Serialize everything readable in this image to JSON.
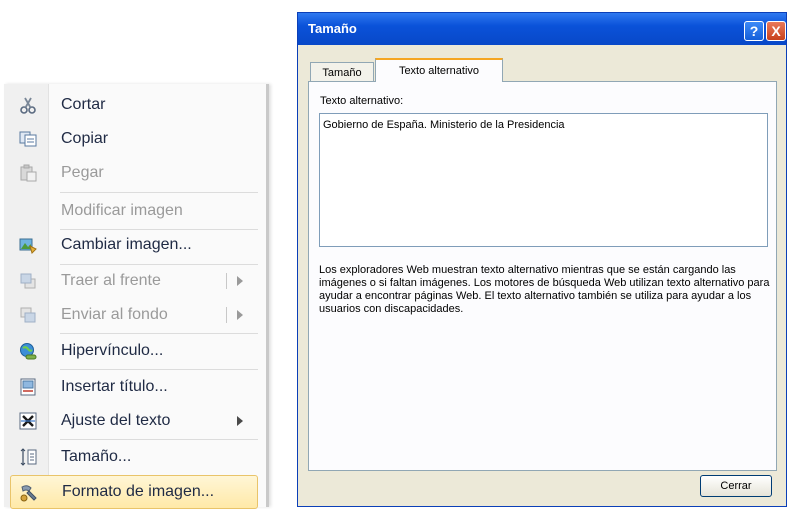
{
  "context_menu": {
    "items": [
      {
        "label": "Cortar",
        "icon": "scissors-icon",
        "enabled": true
      },
      {
        "label": "Copiar",
        "icon": "copy-icon",
        "enabled": true
      },
      {
        "label": "Pegar",
        "icon": "paste-icon",
        "enabled": false
      },
      {
        "label": "Modificar imagen",
        "icon": "",
        "enabled": false
      },
      {
        "label": "Cambiar imagen...",
        "icon": "change-picture-icon",
        "enabled": true
      },
      {
        "label": "Traer al frente",
        "icon": "bring-to-front-icon",
        "enabled": false,
        "submenu": true
      },
      {
        "label": "Enviar al fondo",
        "icon": "send-to-back-icon",
        "enabled": false,
        "submenu": true
      },
      {
        "label": "Hipervínculo...",
        "icon": "hyperlink-icon",
        "enabled": true
      },
      {
        "label": "Insertar título...",
        "icon": "insert-caption-icon",
        "enabled": true
      },
      {
        "label": "Ajuste del texto",
        "icon": "text-wrap-icon",
        "enabled": true,
        "submenu": true
      },
      {
        "label": "Tamaño...",
        "icon": "size-icon",
        "enabled": true
      },
      {
        "label": "Formato de imagen...",
        "icon": "format-picture-icon",
        "enabled": true,
        "highlighted": true
      }
    ]
  },
  "dialog": {
    "title": "Tamaño",
    "tabs": [
      {
        "label": "Tamaño",
        "active": false
      },
      {
        "label": "Texto alternativo",
        "active": true
      }
    ],
    "field_label": "Texto alternativo:",
    "field_value": "Gobierno de España. Ministerio de la Presidencia",
    "description": "Los exploradores Web muestran texto alternativo mientras que se están cargando las imágenes o si faltan imágenes.  Los motores de búsqueda Web utilizan texto alternativo para ayudar a encontrar páginas Web. El texto alternativo también se utiliza para ayudar a los usuarios con discapacidades.",
    "close_button": "Cerrar",
    "help_glyph": "?",
    "close_glyph": "X"
  },
  "colors": {
    "titlebar": "#0a52d9",
    "dialog_bg": "#ece9d8",
    "menu_highlight": "#ffe9a8",
    "menu_text": "#1f2a44"
  }
}
